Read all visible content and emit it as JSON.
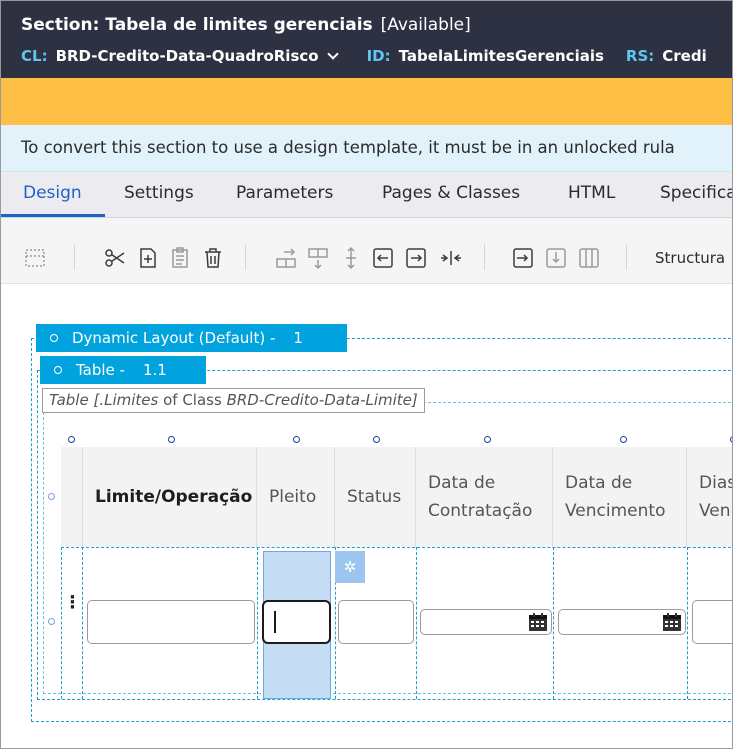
{
  "header": {
    "title": "Section: Tabela de limites gerenciais",
    "availability": "[Available]",
    "cl_key": "CL:",
    "cl_value": "BRD-Credito-Data-QuadroRisco",
    "id_key": "ID:",
    "id_value": "TabelaLimitesGerenciais",
    "rs_key": "RS:",
    "rs_value": "Credi"
  },
  "info_message": "To convert this section to use a design template, it must be in an unlocked rula",
  "tabs": [
    {
      "label": "Design"
    },
    {
      "label": "Settings"
    },
    {
      "label": "Parameters"
    },
    {
      "label": "Pages & Classes"
    },
    {
      "label": "HTML"
    },
    {
      "label": "Specifica"
    }
  ],
  "toolbar": {
    "structural_label": "Structura",
    "icons": [
      "layout-icon",
      "cut-icon",
      "add-icon",
      "paste-icon",
      "delete-icon",
      "insert-row-icon",
      "insert-row-below-icon",
      "move-icon",
      "insert-column-left-icon",
      "insert-column-right-icon",
      "merge-icon",
      "move-right-icon",
      "move-down-icon",
      "columns-icon"
    ]
  },
  "canvas": {
    "dynamic_layout_label": "Dynamic Layout (Default) -",
    "dynamic_layout_num": "1",
    "table_tag_label": "Table -",
    "table_tag_num": "1.1",
    "table_info_prefix": "Table [",
    "table_info_prop": ".Limites",
    "table_info_mid": " of Class ",
    "table_info_class": "BRD-Credito-Data-Limite",
    "table_info_suffix": "]"
  },
  "columns": [
    {
      "header": "Limite/Operação",
      "bold": true
    },
    {
      "header": "Pleito",
      "bold": false
    },
    {
      "header": "Status",
      "bold": false
    },
    {
      "header": "Data de\nContratação",
      "bold": false
    },
    {
      "header": "Data de\nVencimento",
      "bold": false
    },
    {
      "header": "Dias\nVen",
      "bold": false
    }
  ]
}
